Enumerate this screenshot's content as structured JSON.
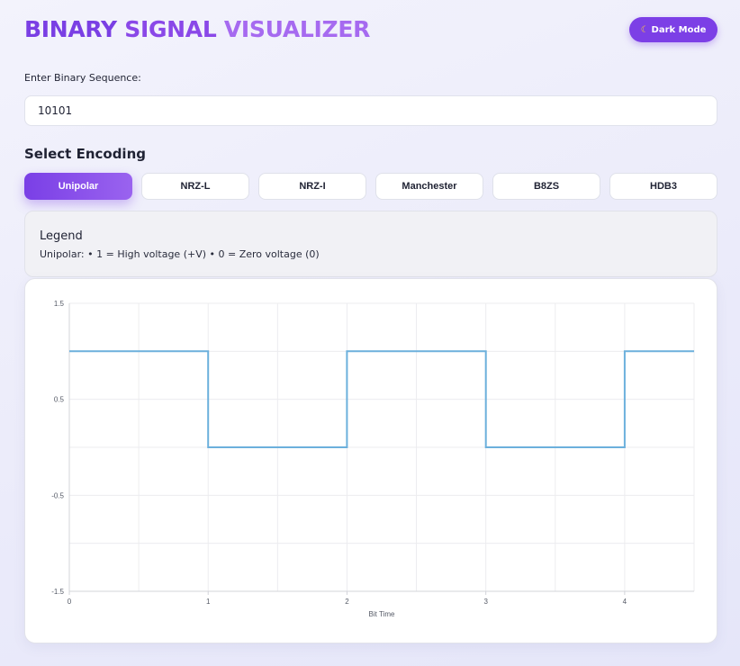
{
  "app": {
    "title_words": [
      "BINARY",
      "SIGNAL",
      "VISUALIZER"
    ],
    "dark_mode_icon": "moon-icon",
    "dark_mode_label": "Dark Mode"
  },
  "input": {
    "label": "Enter Binary Sequence:",
    "value": "10101"
  },
  "encoding": {
    "section_title": "Select Encoding",
    "options": [
      "Unipolar",
      "NRZ-L",
      "NRZ-I",
      "Manchester",
      "B8ZS",
      "HDB3"
    ],
    "selected": "Unipolar"
  },
  "legend": {
    "title": "Legend",
    "text": "Unipolar: • 1 = High voltage (+V) • 0 = Zero voltage (0)"
  },
  "colors": {
    "accent": "#7c3fe6",
    "signal_line": "#6cb0dc",
    "grid": "#ececef"
  },
  "chart_data": {
    "type": "line",
    "step": true,
    "xlabel": "Bit Time",
    "ylabel": "",
    "xlim": [
      0,
      4.5
    ],
    "ylim": [
      -1.5,
      1.5
    ],
    "x_ticks": [
      0,
      1,
      2,
      3,
      4
    ],
    "y_ticks": [
      {
        "value": 1.5,
        "label": "1.5"
      },
      {
        "value": 0.5,
        "label": "0.5"
      },
      {
        "value": -0.5,
        "label": "-0.5"
      },
      {
        "value": -1.5,
        "label": "-1.5"
      }
    ],
    "series": [
      {
        "color": "#6cb0dc",
        "points": [
          [
            0,
            1
          ],
          [
            1,
            1
          ],
          [
            1,
            0
          ],
          [
            2,
            0
          ],
          [
            2,
            1
          ],
          [
            3,
            1
          ],
          [
            3,
            0
          ],
          [
            4,
            0
          ],
          [
            4,
            1
          ],
          [
            4.5,
            1
          ]
        ]
      }
    ],
    "grid": true
  }
}
